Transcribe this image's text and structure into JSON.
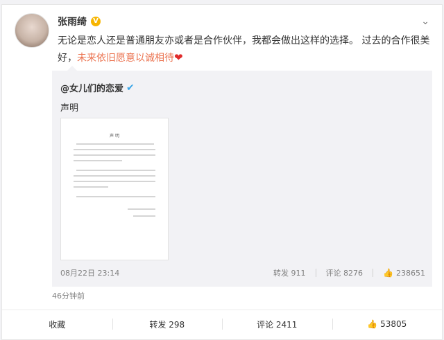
{
  "post": {
    "author": "张雨绮",
    "text_main": "无论是恋人还是普通朋友亦或者是合作伙伴，我都会做出这样的选择。 过去的合作很美好，",
    "text_highlight": "未来依旧愿意以诚相待",
    "time": "46分钟前"
  },
  "quoted": {
    "author": "@女儿们的恋爱",
    "text": "声明",
    "image_title": "声 明",
    "date": "08月22日 23:14",
    "repost": "转发 911",
    "comment": "评论 8276",
    "likes": "238651"
  },
  "actions": {
    "favorite": "收藏",
    "repost": "转发 298",
    "comment": "评论 2411",
    "likes": "53805"
  },
  "icons": {
    "verified": "verified-badge-icon",
    "blue_verified": "blue-v-icon",
    "heart": "heart-icon",
    "thumb": "thumb-up-icon",
    "chevron": "chevron-down-icon"
  },
  "colors": {
    "accent": "#eb7350",
    "badge": "#f7b500",
    "heart": "#e02b2b"
  }
}
